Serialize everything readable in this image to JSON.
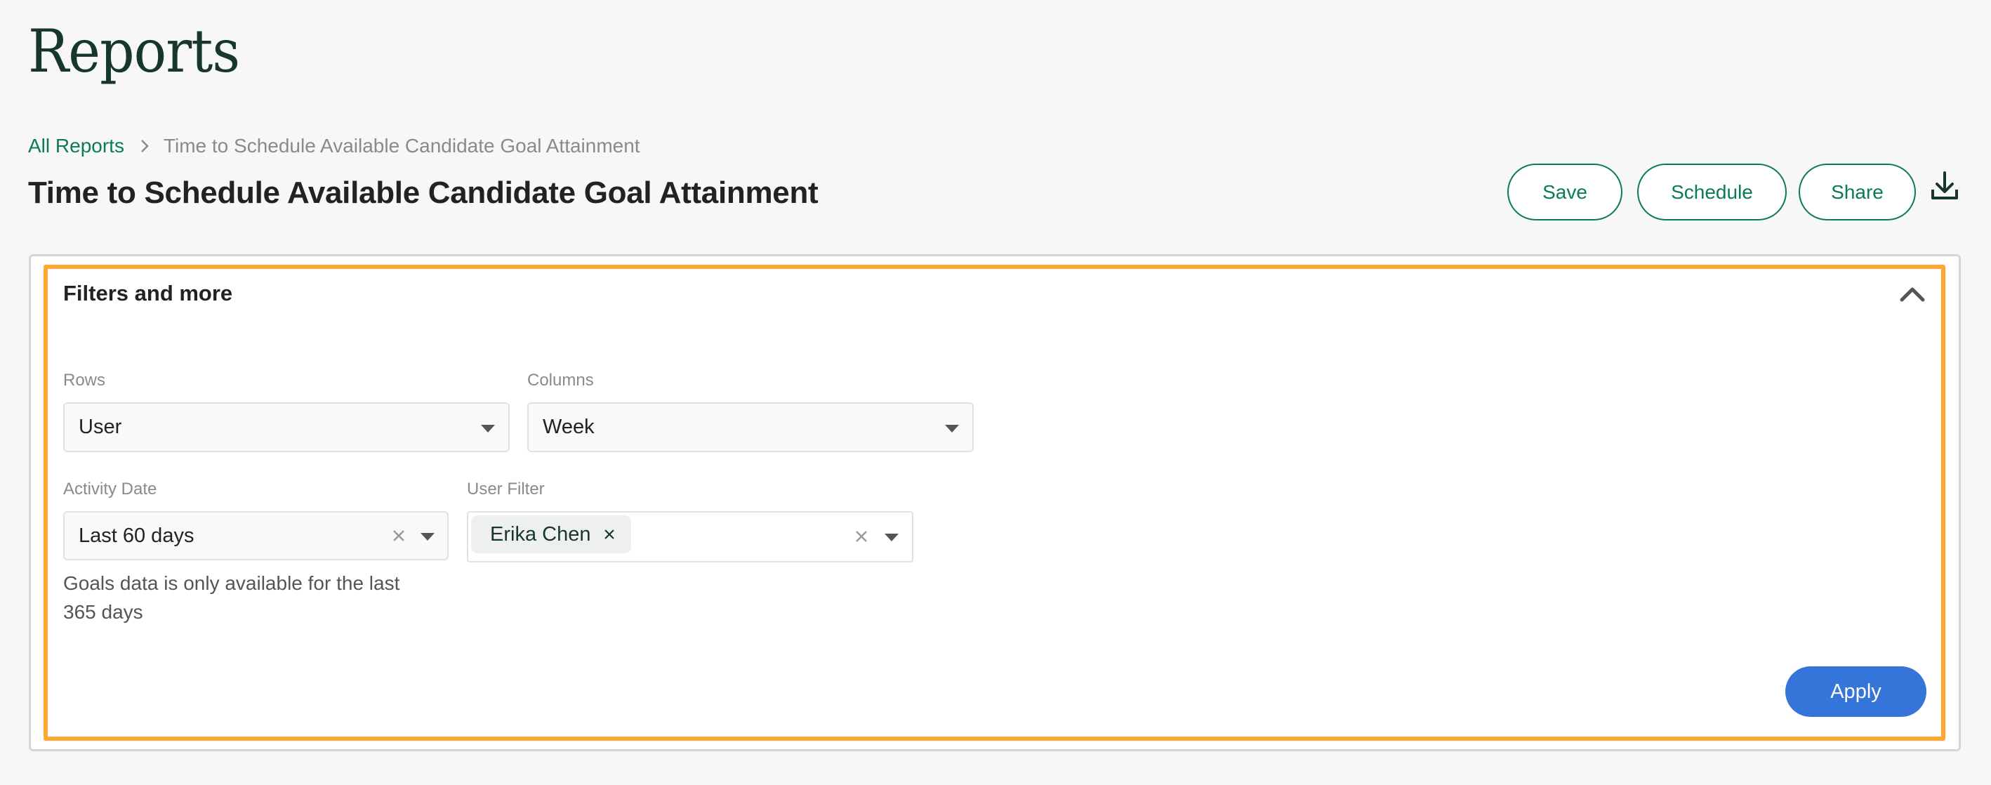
{
  "page": {
    "heading": "Reports"
  },
  "breadcrumb": {
    "items": [
      {
        "label": "All Reports",
        "link": true
      },
      {
        "label": "Time to Schedule Available Candidate Goal Attainment",
        "link": false
      }
    ],
    "separator_icon": "chevron-right-icon"
  },
  "report": {
    "title": "Time to Schedule Available Candidate Goal Attainment"
  },
  "toolbar": {
    "save_label": "Save",
    "schedule_label": "Schedule",
    "share_label": "Share",
    "download_icon": "download-icon"
  },
  "filters": {
    "title": "Filters and more",
    "collapse_icon": "chevron-up-icon",
    "rows": {
      "label": "Rows",
      "value": "User"
    },
    "columns": {
      "label": "Columns",
      "value": "Week"
    },
    "activity_date": {
      "label": "Activity Date",
      "value": "Last 60 days",
      "helper": "Goals data is only available for the last 365 days",
      "helper_line1": "Goals data is only available for the last",
      "helper_line2": "365 days"
    },
    "user_filter": {
      "label": "User Filter",
      "selected": [
        "Erika Chen"
      ]
    },
    "apply_label": "Apply"
  },
  "colors": {
    "brand_green": "#0b7a5c",
    "heading_green": "#17372c",
    "primary_blue": "#3574d8",
    "highlight_orange": "#ffa530",
    "background": "#f7f7f7"
  }
}
